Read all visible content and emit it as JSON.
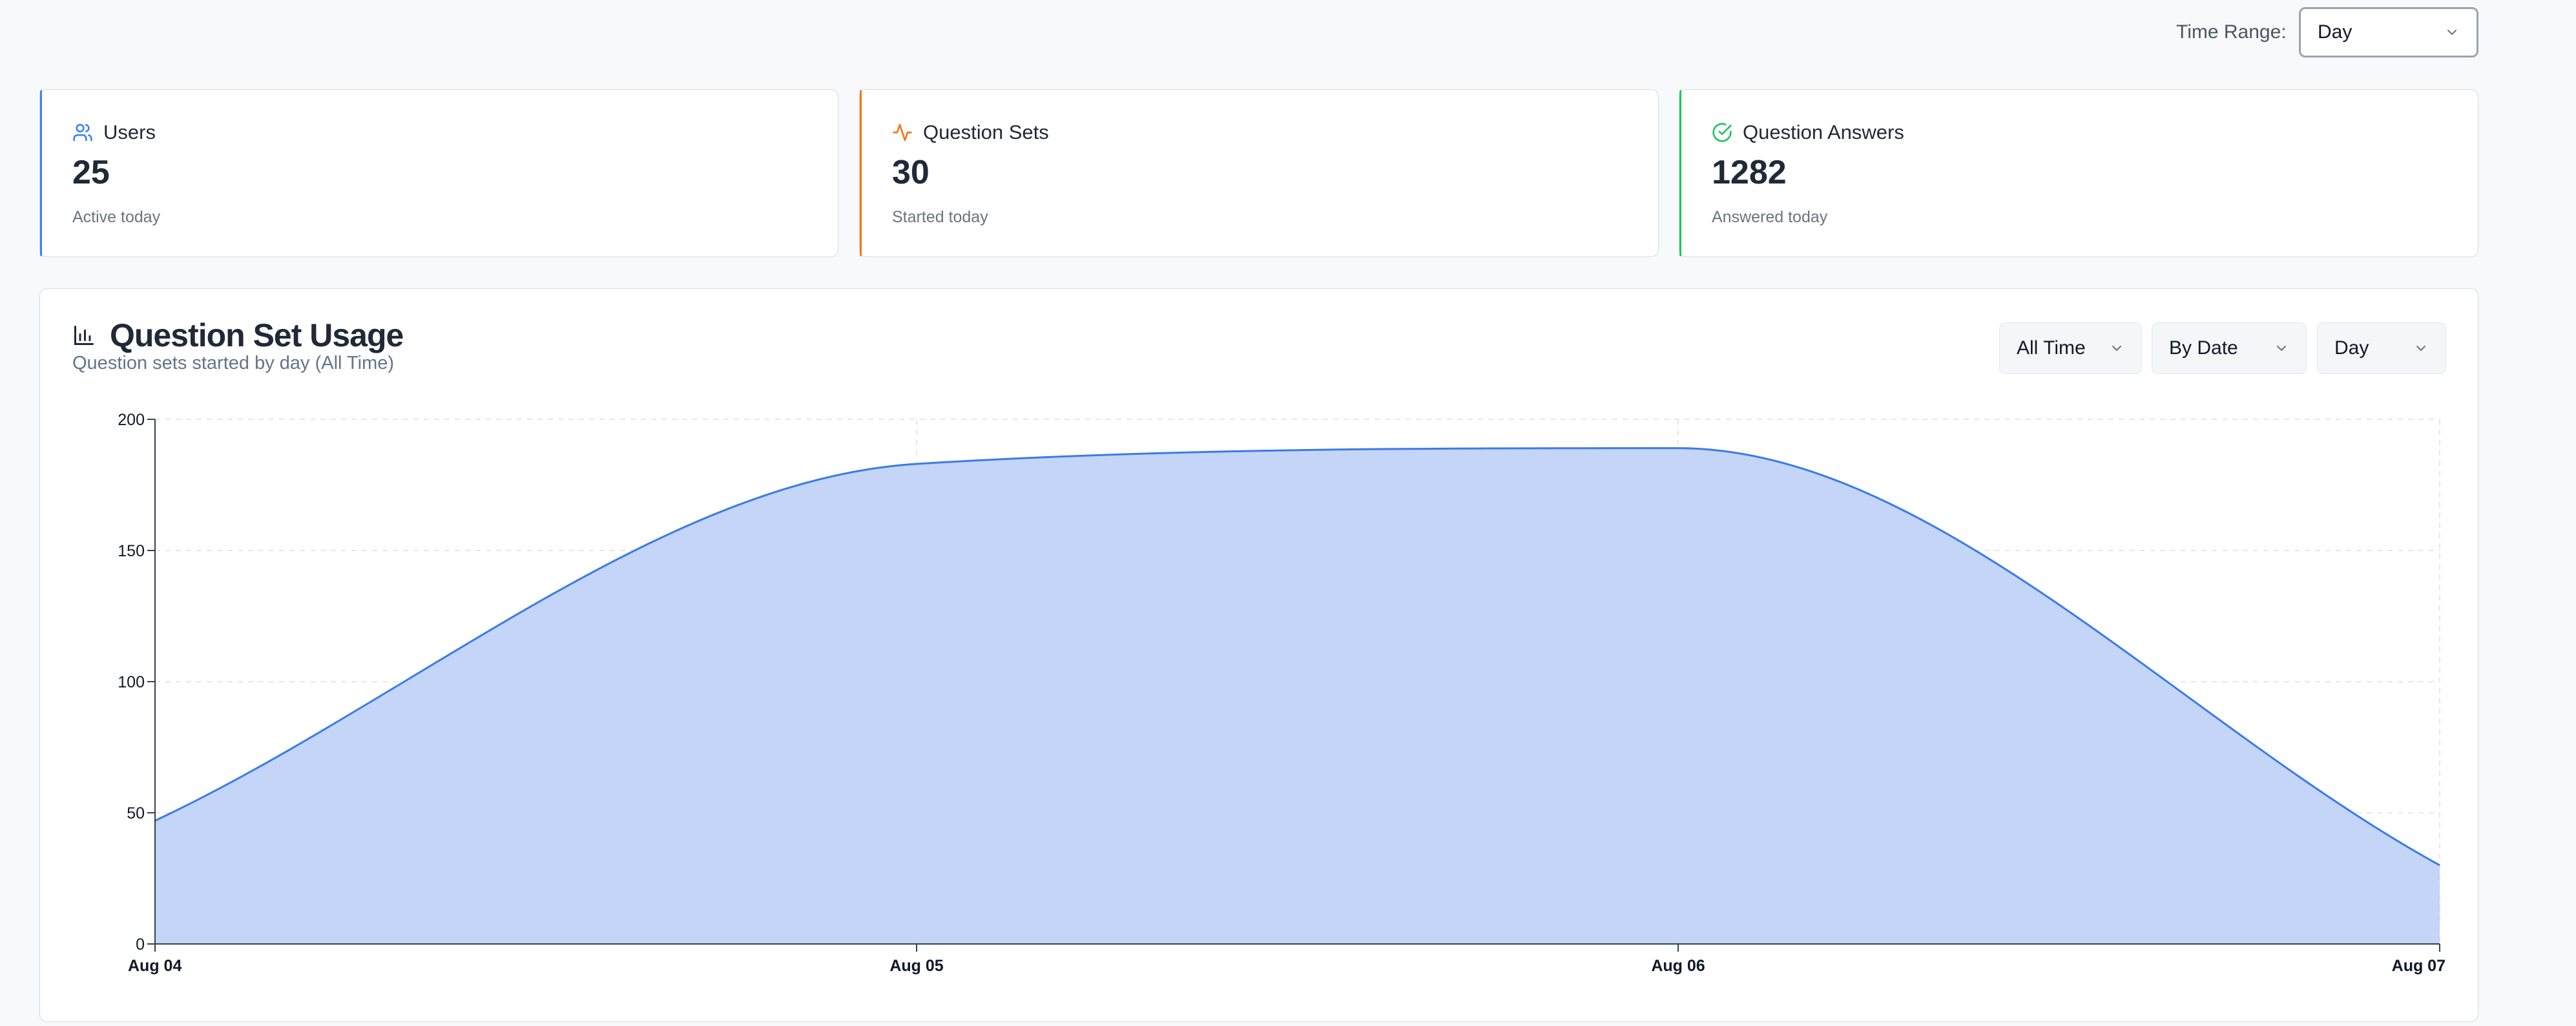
{
  "top": {
    "time_range_label": "Time Range:",
    "time_range_value": "Day"
  },
  "cards": [
    {
      "title": "Users",
      "value": "25",
      "sub": "Active today",
      "icon": "users-icon",
      "color": "#3b82f6"
    },
    {
      "title": "Question Sets",
      "value": "30",
      "sub": "Started today",
      "icon": "activity-icon",
      "color": "#f97316"
    },
    {
      "title": "Question Answers",
      "value": "1282",
      "sub": "Answered today",
      "icon": "check-circle-icon",
      "color": "#22c55e"
    }
  ],
  "panel": {
    "title": "Question Set Usage",
    "subtitle": "Question sets started by day (All Time)",
    "filters": {
      "range": "All Time",
      "group": "By Date",
      "interval": "Day"
    }
  },
  "colors": {
    "area_fill": "#c4d5f7",
    "area_stroke": "#3b7be6",
    "grid": "#e5e7eb",
    "axis": "#374151"
  },
  "chart_data": {
    "type": "area",
    "x": [
      "Aug 04",
      "Aug 05",
      "Aug 06",
      "Aug 07"
    ],
    "values": [
      47,
      183,
      189,
      30
    ],
    "y_ticks": [
      0,
      50,
      100,
      150,
      200
    ],
    "ylim": [
      0,
      200
    ],
    "grid": true,
    "curve": "smooth"
  }
}
